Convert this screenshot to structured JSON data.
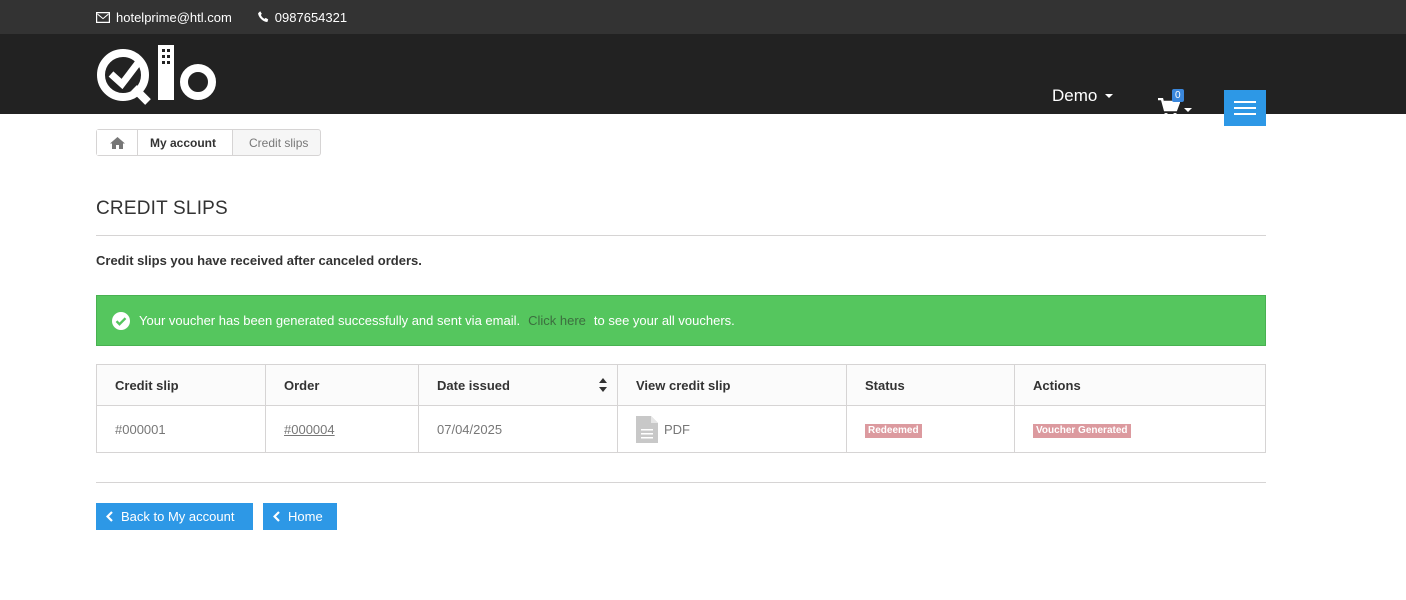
{
  "topbar": {
    "email": "hotelprime@htl.com",
    "phone": "0987654321"
  },
  "header": {
    "logo_text": "Qlo",
    "user_label": "Demo",
    "cart_count": "0"
  },
  "breadcrumb": {
    "items": [
      "My account",
      "Credit slips"
    ]
  },
  "page": {
    "title": "CREDIT SLIPS",
    "intro": "Credit slips you have received after canceled orders."
  },
  "alert": {
    "text_before": "Your voucher has been generated successfully and sent via email.",
    "link": "Click here",
    "text_after": "to see your all vouchers."
  },
  "table": {
    "headers": [
      "Credit slip",
      "Order",
      "Date issued",
      "View credit slip",
      "Status",
      "Actions"
    ],
    "rows": [
      {
        "credit_slip": "#000001",
        "order": "#000004",
        "date": "07/04/2025",
        "view": "PDF",
        "status": "Redeemed",
        "action": "Voucher Generated"
      }
    ]
  },
  "buttons": {
    "back": "Back to My account",
    "home": "Home"
  },
  "colors": {
    "topbar": "#333333",
    "header": "#222222",
    "accent": "#2d98e6",
    "success": "#55c65e",
    "label": "#dc9a9f"
  }
}
